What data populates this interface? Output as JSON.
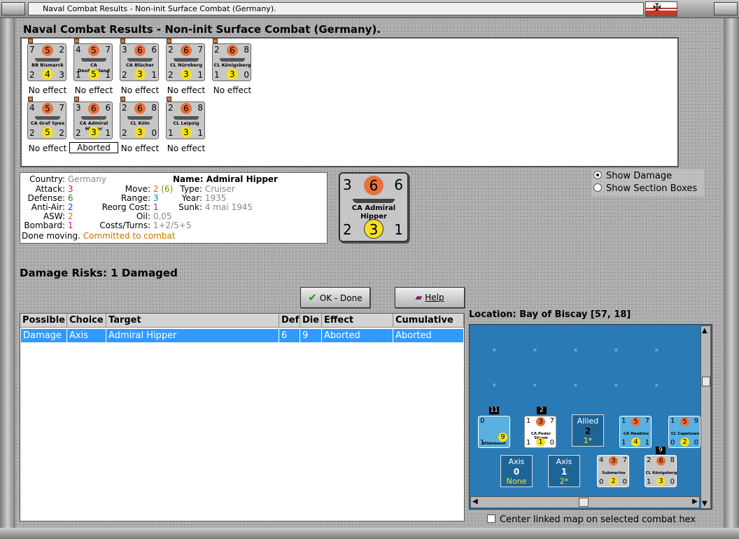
{
  "window": {
    "title": "Naval Combat Results - Non-init Surface Combat (Germany)."
  },
  "heading": "Naval Combat Results - Non-init Surface Combat (Germany).",
  "units": [
    {
      "attack": "7",
      "defense": "5",
      "move": "2",
      "name": "BB Bismarck",
      "aa": "2",
      "def2": "4",
      "asw": "3",
      "result": "No effect"
    },
    {
      "attack": "4",
      "defense": "5",
      "move": "7",
      "name": "CA Deutschland",
      "aa": "1",
      "def2": "5",
      "asw": "1",
      "result": "No effect"
    },
    {
      "attack": "3",
      "defense": "6",
      "move": "6",
      "name": "CA Blücher",
      "aa": "2",
      "def2": "3",
      "asw": "1",
      "result": "No effect"
    },
    {
      "attack": "2",
      "defense": "6",
      "move": "7",
      "name": "CL Nürnberg",
      "aa": "2",
      "def2": "3",
      "asw": "1",
      "result": "No effect"
    },
    {
      "attack": "2",
      "defense": "6",
      "move": "8",
      "name": "CL Königsberg",
      "aa": "1",
      "def2": "3",
      "asw": "0",
      "result": "No effect"
    },
    {
      "attack": "4",
      "defense": "5",
      "move": "7",
      "name": "CA Graf Spee",
      "aa": "2",
      "def2": "5",
      "asw": "2",
      "result": "No effect"
    },
    {
      "attack": "3",
      "defense": "6",
      "move": "6",
      "name": "CA Admiral Hipper",
      "aa": "2",
      "def2": "3",
      "asw": "1",
      "result": "Aborted"
    },
    {
      "attack": "2",
      "defense": "6",
      "move": "8",
      "name": "CL Köln",
      "aa": "2",
      "def2": "3",
      "asw": "0",
      "result": "No effect"
    },
    {
      "attack": "2",
      "defense": "6",
      "move": "8",
      "name": "CL Leipzig",
      "aa": "1",
      "def2": "3",
      "asw": "1",
      "result": "No effect"
    }
  ],
  "info": {
    "country_label": "Country:",
    "country": "Germany",
    "attack_label": "Attack:",
    "attack": "3",
    "defense_label": "Defense:",
    "defense": "6",
    "antiair_label": "Anti-Air:",
    "antiair": "2",
    "asw_label": "ASW:",
    "asw": "2",
    "bombard_label": "Bombard:",
    "bombard": "1",
    "name_label": "Name:",
    "name": "Admiral Hipper",
    "move_label": "Move:",
    "move": "2",
    "move_extra": "(6)",
    "type_label": "Type:",
    "type": "Cruiser",
    "range_label": "Range:",
    "range": "3",
    "year_label": "Year:",
    "year": "1935",
    "reorg_label": "Reorg Cost:",
    "reorg": "1",
    "sunk_label": "Sunk:",
    "sunk": "4 mai 1945",
    "oil_label": "Oil:",
    "oil": "0,05",
    "costs_label": "Costs/Turns:",
    "costs": "1+2/5+5",
    "status": "Done moving.",
    "status2": "Committed to combat"
  },
  "big_counter": {
    "attack": "3",
    "defense": "6",
    "move": "6",
    "name": "CA Admiral Hipper",
    "aa": "2",
    "def2": "3",
    "asw": "1"
  },
  "options": {
    "show_damage": "Show Damage",
    "show_sections": "Show Section Boxes"
  },
  "damage_risks": "Damage Risks:  1 Damaged",
  "buttons": {
    "ok": "OK - Done",
    "help": "Help"
  },
  "table": {
    "headers": [
      "Possible",
      "Choice",
      "Target",
      "Def",
      "Die",
      "Effect",
      "Cumulative"
    ],
    "rows": [
      [
        "Damage",
        "Axis",
        "Admiral Hipper",
        "6",
        "9",
        "Aborted",
        "Aborted"
      ]
    ]
  },
  "location": "Location:  Bay of Biscay [57, 18]",
  "map": {
    "units": [
      {
        "name": "Vildebeest",
        "stack": "11",
        "aa": "1",
        "def2": "9",
        "attack": "0"
      },
      {
        "name": "CA Peder Skram",
        "stack": "2",
        "attack": "1",
        "defense": "3",
        "move": "7",
        "aa": "1",
        "def2": "1",
        "asw": "0"
      },
      {
        "name": "CA Hawkins",
        "attack": "1",
        "defense": "5",
        "move": "7",
        "aa": "1",
        "def2": "4",
        "asw": "1"
      },
      {
        "name": "CL Capetown",
        "attack": "1",
        "defense": "5",
        "move": "9",
        "aa": "0",
        "def2": "2",
        "asw": "0"
      },
      {
        "name": "Submarine",
        "attack": "4",
        "defense": "3",
        "move": "7",
        "aa": "0",
        "def2": "2",
        "asw": "0"
      },
      {
        "name": "CL Königsberg",
        "stack": "9",
        "attack": "2",
        "defense": "6",
        "move": "8",
        "aa": "1",
        "def2": "3",
        "asw": "0"
      }
    ],
    "allied": {
      "label": "Allied",
      "value": "2",
      "sub": "1*"
    },
    "axis1": {
      "label": "Axis",
      "value": "0",
      "sub": "None"
    },
    "axis2": {
      "label": "Axis",
      "value": "1",
      "sub": "2*"
    }
  },
  "center_map": "Center linked map on selected combat hex"
}
